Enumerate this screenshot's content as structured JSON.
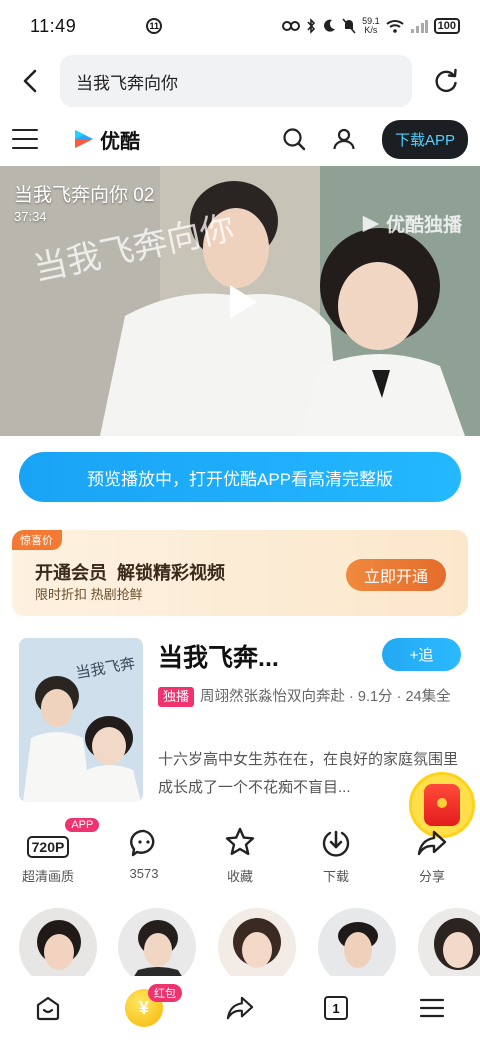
{
  "status_bar": {
    "time": "11:49",
    "net_speed": "59.1\nK/s",
    "battery": "100"
  },
  "browser": {
    "url_text": "当我飞奔向你"
  },
  "site": {
    "logo_text": "优酷",
    "download_app_label": "下载APP"
  },
  "video": {
    "title": "当我飞奔向你 02",
    "duration": "37:34",
    "watermark": "优酷独播",
    "calligraphy": "当我飞奔向你"
  },
  "cta": {
    "open_app_label": "预览播放中，打开优酷APP看高清完整版"
  },
  "vip": {
    "tag": "惊喜价",
    "title": "开通会员  解锁精彩视频",
    "subtitle": "限时折扣 热剧抢鲜",
    "button": "立即开通"
  },
  "show": {
    "title": "当我飞奔...",
    "follow_label": "+追",
    "badge": "独播",
    "meta": "周翊然张淼怡双向奔赴 · 9.1分 · 24集全",
    "description": "十六岁高中女生苏在在，在良好的家庭氛围里成长成了一个不花痴不盲目..."
  },
  "actions": [
    {
      "label": "超清画质",
      "icon_text": "720P",
      "badge": "APP"
    },
    {
      "label": "3573",
      "icon": "comment-icon"
    },
    {
      "label": "收藏",
      "icon": "star-icon"
    },
    {
      "label": "下载",
      "icon": "download-icon"
    },
    {
      "label": "分享",
      "icon": "share-icon"
    }
  ],
  "bottom_nav": {
    "hongbao_label": "红包",
    "coin_symbol": "¥",
    "tab_count": "1"
  },
  "colors": {
    "accent_blue": "#23b8ff",
    "brand_dark": "#1b1f24",
    "vip_orange": "#e46c2a",
    "badge_pink": "#f0326e"
  }
}
